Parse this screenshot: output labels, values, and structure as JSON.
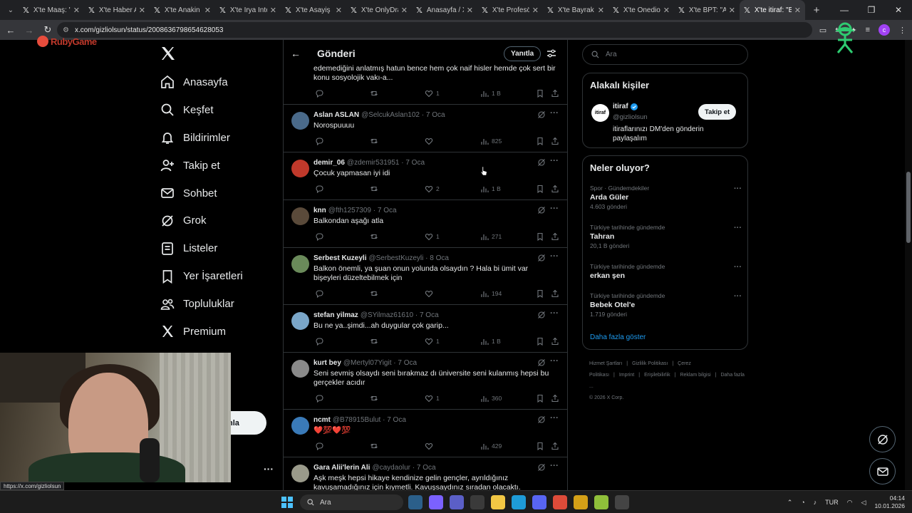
{
  "browser": {
    "tabs": [
      {
        "label": "X'te Maaş: \"y"
      },
      {
        "label": "X'te Haber A"
      },
      {
        "label": "X'te Anakin S"
      },
      {
        "label": "X'te İrya İnte"
      },
      {
        "label": "X'te Asayiş B"
      },
      {
        "label": "X'te OnlyDra"
      },
      {
        "label": "Anasayfa / X"
      },
      {
        "label": "X'te Profesör"
      },
      {
        "label": "X'te Bayrak H"
      },
      {
        "label": "X'te Onedio:"
      },
      {
        "label": "X'te BPT: \"Ar"
      },
      {
        "label": "X'te itiraf: \"B"
      }
    ],
    "url": "x.com/gizliolsun/status/2008636798654628053",
    "profile_letter": "c",
    "status_link": "https://x.com/gizliolsun"
  },
  "overlay": {
    "stream_logo": "RubyGame"
  },
  "nav": {
    "items": [
      {
        "label": "Anasayfa",
        "icon": "home-icon"
      },
      {
        "label": "Keşfet",
        "icon": "search-icon"
      },
      {
        "label": "Bildirimler",
        "icon": "bell-icon"
      },
      {
        "label": "Takip et",
        "icon": "person-add-icon"
      },
      {
        "label": "Sohbet",
        "icon": "mail-icon"
      },
      {
        "label": "Grok",
        "icon": "grok-icon"
      },
      {
        "label": "Listeler",
        "icon": "list-icon"
      },
      {
        "label": "Yer İşaretleri",
        "icon": "bookmark-icon"
      },
      {
        "label": "Topluluklar",
        "icon": "people-icon"
      },
      {
        "label": "Premium",
        "icon": "x-icon"
      }
    ],
    "post_button": "nla"
  },
  "main": {
    "title": "Gönderi",
    "reply_button": "Yanıtla",
    "top_tweet": {
      "text": "edemediğini anlatmış hatun bence hem çok naif hisler hemde çok sert bir konu sosyolojik vakı-a...",
      "likes": "1",
      "views": "1 B"
    },
    "tweets": [
      {
        "name": "Aslan ASLAN",
        "handle": "@SelcukAslan102",
        "date": "7 Oca",
        "text": "Norospuuuu",
        "replies": "",
        "retweets": "",
        "likes": "",
        "views": "825",
        "avatar_color": "#4a6a8a"
      },
      {
        "name": "demir_06",
        "handle": "@zdemir531951",
        "date": "7 Oca",
        "text": "Çocuk yapmasan iyi idi",
        "replies": "",
        "retweets": "",
        "likes": "2",
        "views": "1 B",
        "avatar_color": "#c0392b"
      },
      {
        "name": "knn",
        "handle": "@fth1257309",
        "date": "7 Oca",
        "text": "Balkondan aşağı atla",
        "replies": "",
        "retweets": "",
        "likes": "1",
        "views": "271",
        "avatar_color": "#5a4a3a"
      },
      {
        "name": "Serbest Kuzeyli",
        "handle": "@SerbestKuzeyli",
        "date": "8 Oca",
        "text": "Balkon önemli, ya şuan onun yolunda olsaydın ? Hala bi ümit var bişeyleri düzeltebilmek için",
        "replies": "",
        "retweets": "",
        "likes": "",
        "views": "194",
        "avatar_color": "#6a8a5a"
      },
      {
        "name": "stefan yilmaz",
        "handle": "@SYilmaz61610",
        "date": "7 Oca",
        "text": "Bu ne ya..şimdi...ah duygular çok garip...",
        "replies": "",
        "retweets": "",
        "likes": "1",
        "views": "1 B",
        "avatar_color": "#7aa6c8"
      },
      {
        "name": "kurt bey",
        "handle": "@Mertyl07Yigit",
        "date": "7 Oca",
        "text": "Seni sevmiş olsaydı seni bırakmaz dı üniversite seni kulanmış hepsi bu gerçekler acıdır",
        "replies": "",
        "retweets": "",
        "likes": "1",
        "views": "360",
        "avatar_color": "#8a8a8a"
      },
      {
        "name": "ncmt",
        "handle": "@B78915Bulut",
        "date": "7 Oca",
        "text": "❤️💯❤️💯",
        "replies": "",
        "retweets": "",
        "likes": "",
        "views": "429",
        "avatar_color": "#3a7ab8"
      },
      {
        "name": "Gara Alii'lerin Ali",
        "handle": "@caydaolur",
        "date": "7 Oca",
        "text": "Aşk meşk hepsi hikaye kendinize gelin gençler, ayrıldığınız kavuşamadığınız için kıymetli. Kavuşsaydınız sıradan olacaktı.",
        "replies": "",
        "retweets": "",
        "likes": "",
        "views": "",
        "avatar_color": "#9a9a8a"
      }
    ]
  },
  "right": {
    "search_placeholder": "Ara",
    "related": {
      "title": "Alakalı kişiler",
      "name": "itiraf",
      "handle": "@gizliolsun",
      "bio": "itiraflarınızı DM'den gönderin paylaşalım",
      "follow": "Takip et",
      "avatar_text": "itiraf"
    },
    "trends": {
      "title": "Neler oluyor?",
      "items": [
        {
          "category": "Spor · Gündemdekiler",
          "title": "Arda Güler",
          "count": "4.603 gönderi"
        },
        {
          "category": "Türkiye tarihinde gündemde",
          "title": "Tahran",
          "count": "20,1 B gönderi"
        },
        {
          "category": "Türkiye tarihinde gündemde",
          "title": "erkan şen",
          "count": ""
        },
        {
          "category": "Türkiye tarihinde gündemde",
          "title": "Bebek Otel'e",
          "count": "1.719 gönderi"
        }
      ],
      "show_more": "Daha fazla göster"
    },
    "footer": {
      "links": [
        "Hizmet Şartları",
        "|",
        "Gizlilik Politikası",
        "|",
        "Çerez Politikası",
        "|",
        "Imprint",
        "|",
        "Erişilebilirlik",
        "|",
        "Reklam bilgisi",
        "|",
        "Daha fazla ..."
      ],
      "copyright": "© 2026 X Corp."
    }
  },
  "taskbar": {
    "search": "Ara",
    "lang": "TUR",
    "time": "04:14",
    "date": "10.01.2026"
  }
}
